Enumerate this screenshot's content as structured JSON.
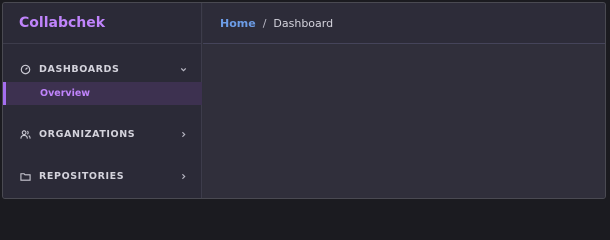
{
  "app": {
    "brand": "Collabchek"
  },
  "breadcrumb": {
    "home": "Home",
    "separator": "/",
    "current": "Dashboard"
  },
  "sidebar": {
    "sections": [
      {
        "label": "DASHBOARDS",
        "icon": "gauge-icon",
        "expanded": true,
        "items": [
          {
            "label": "Overview",
            "active": true
          }
        ]
      },
      {
        "label": "ORGANIZATIONS",
        "icon": "users-icon",
        "expanded": false
      },
      {
        "label": "REPOSITORIES",
        "icon": "folder-icon",
        "expanded": false
      }
    ]
  },
  "colors": {
    "accent": "#c084fc",
    "link": "#6c9ce6",
    "active_bg": "#3d3150",
    "active_bar": "#a56ef0"
  }
}
